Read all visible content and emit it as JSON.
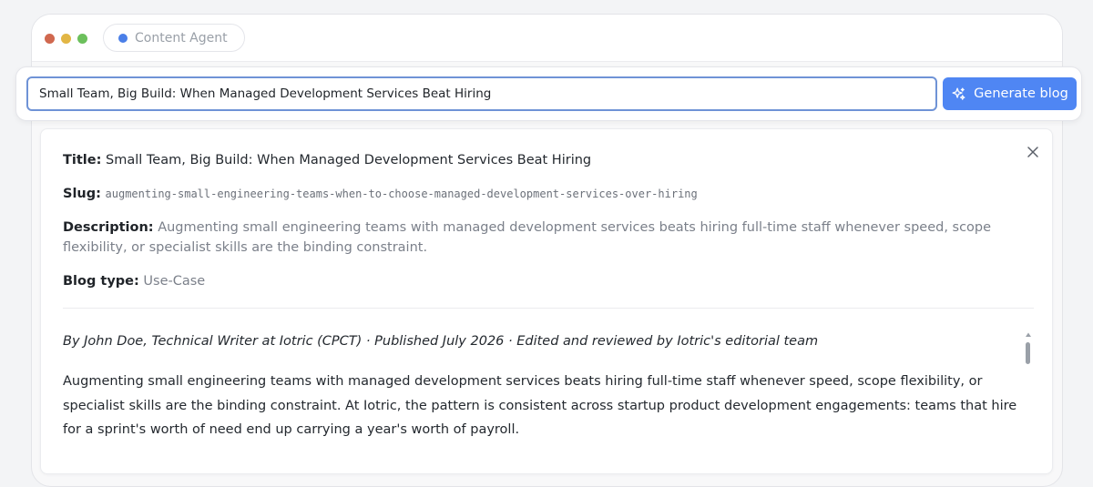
{
  "window": {
    "tab_label": "Content Agent"
  },
  "composer": {
    "topic_value": "Small Team, Big Build: When Managed Development Services Beat Hiring",
    "generate_label": "Generate blog"
  },
  "result": {
    "title_label": "Title:",
    "title_value": "Small Team, Big Build: When Managed Development Services Beat Hiring",
    "slug_label": "Slug:",
    "slug_value": "augmenting-small-engineering-teams-when-to-choose-managed-development-services-over-hiring",
    "description_label": "Description:",
    "description_value": "Augmenting small engineering teams with managed development services beats hiring full-time staff whenever speed, scope flexibility, or specialist skills are the binding constraint.",
    "blog_type_label": "Blog type:",
    "blog_type_value": "Use-Case",
    "byline": "By John Doe, Technical Writer at Iotric (CPCT) · Published July 2026 · Edited and reviewed by Iotric's editorial team",
    "paragraph_1": "Augmenting small engineering teams with managed development services beats hiring full-time staff whenever speed, scope flexibility, or specialist skills are the binding constraint. At Iotric, the pattern is consistent across startup product development engagements: teams that hire for a sprint's worth of need end up carrying a year's worth of payroll."
  },
  "colors": {
    "accent": "#4f86f3",
    "tab_dot": "#4a7fe8",
    "traffic_red": "#d0684f",
    "traffic_yellow": "#e2b645",
    "traffic_green": "#6cc05c"
  }
}
